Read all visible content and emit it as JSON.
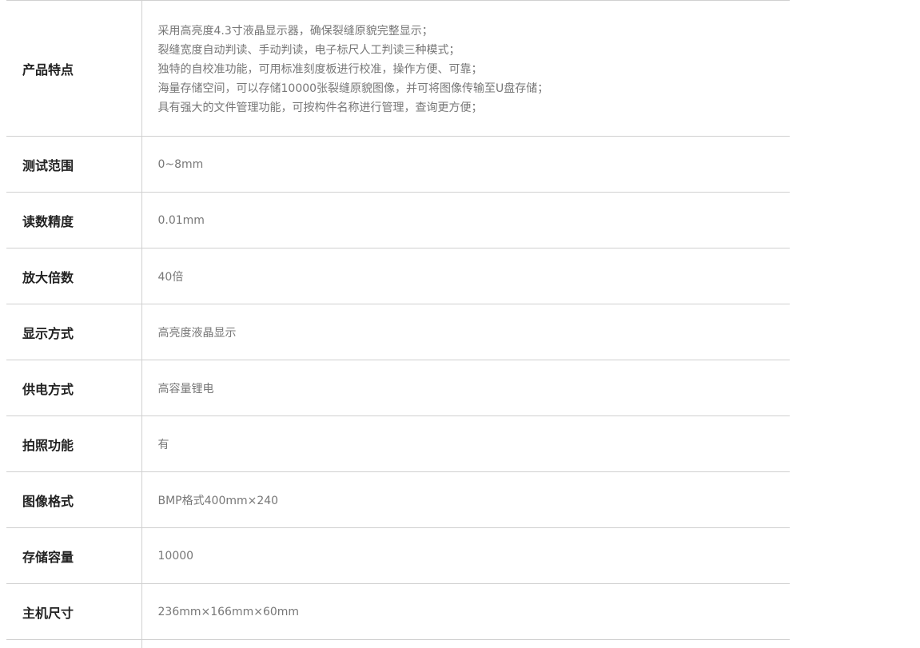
{
  "specs": [
    {
      "label": "产品特点",
      "lines": [
        "采用高亮度4.3寸液晶显示器，确保裂缝原貌完整显示；",
        "裂缝宽度自动判读、手动判读，电子标尺人工判读三种模式；",
        "独特的自校准功能，可用标准刻度板进行校准，操作方便、可靠；",
        "海量存储空间，可以存储10000张裂缝原貌图像，并可将图像传输至U盘存储；",
        "具有强大的文件管理功能，可按构件名称进行管理，查询更方便；"
      ]
    },
    {
      "label": "测试范围",
      "value": "0~8mm"
    },
    {
      "label": "读数精度",
      "value": "0.01mm"
    },
    {
      "label": "放大倍数",
      "value": "40倍"
    },
    {
      "label": "显示方式",
      "value": "高亮度液晶显示"
    },
    {
      "label": "供电方式",
      "value": "高容量锂电"
    },
    {
      "label": "拍照功能",
      "value": "有"
    },
    {
      "label": "图像格式",
      "value": "BMP格式400mm×240"
    },
    {
      "label": "存储容量",
      "value": "10000"
    },
    {
      "label": "主机尺寸",
      "value": "236mm×166mm×60mm"
    }
  ]
}
